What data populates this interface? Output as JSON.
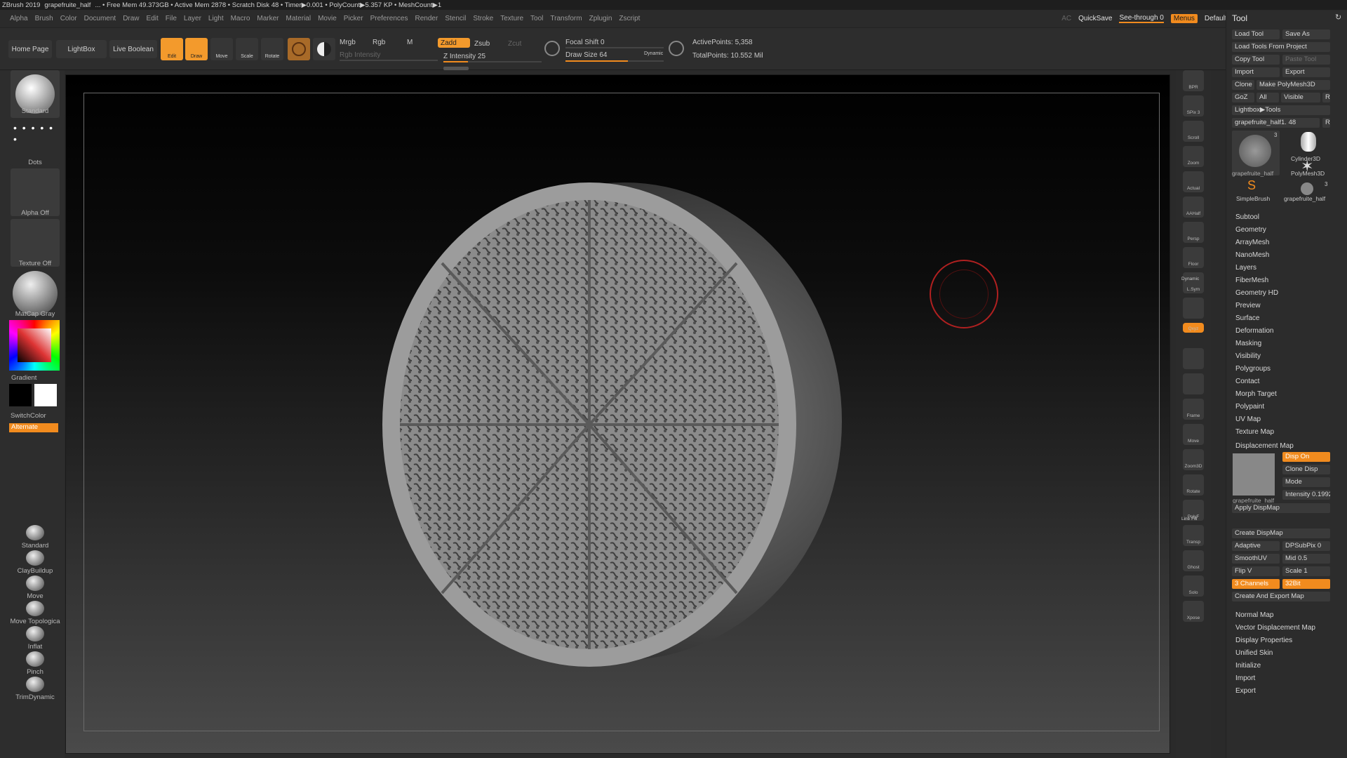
{
  "titlebar": {
    "app": "ZBrush 2019",
    "file": "grapefruite_half",
    "stats": "... • Free Mem 49.373GB • Active Mem 2878 • Scratch Disk 48 • Timer▶0.001 • PolyCount▶5.357 KP • MeshCount▶1"
  },
  "menu": [
    "Alpha",
    "Brush",
    "Color",
    "Document",
    "Draw",
    "Edit",
    "File",
    "Layer",
    "Light",
    "Macro",
    "Marker",
    "Material",
    "Movie",
    "Picker",
    "Preferences",
    "Render",
    "Stencil",
    "Stroke",
    "Texture",
    "Tool",
    "Transform",
    "Zplugin",
    "Zscript"
  ],
  "menu_right": {
    "ac": "AC",
    "quicksave": "QuickSave",
    "seethrough": "See-through  0",
    "menus": "Menus",
    "script": "DefaultZScript"
  },
  "controls": {
    "home": "Home Page",
    "lightbox": "LightBox",
    "live_boolean": "Live Boolean",
    "edit": "Edit",
    "draw": "Draw",
    "move": "Move",
    "scale": "Scale",
    "rotate": "Rotate",
    "mrgb": "Mrgb",
    "rgb": "Rgb",
    "m": "M",
    "rgb_intensity": "Rgb Intensity",
    "zadd": "Zadd",
    "zsub": "Zsub",
    "zcut": "Zcut",
    "z_intensity": "Z Intensity 25",
    "focal_shift": "Focal Shift 0",
    "draw_size": "Draw Size 64",
    "dynamic": "Dynamic",
    "active_points": "ActivePoints: 5,358",
    "total_points": "TotalPoints: 10.552 Mil",
    "z_intensity_value": 25,
    "draw_size_value": 64
  },
  "left": {
    "standard": "Standard",
    "dots": "Dots",
    "alpha_off": "Alpha Off",
    "texture_off": "Texture Off",
    "matcap": "MatCap Gray",
    "gradient": "Gradient",
    "switchcolor": "SwitchColor",
    "alternate": "Alternate",
    "brushes": [
      "Standard",
      "ClayBuildup",
      "Move",
      "Move Topologica",
      "Inflat",
      "Pinch",
      "TrimDynamic"
    ]
  },
  "right_shelf": [
    "BPR",
    "SPix 3",
    "Scroll",
    "Zoom",
    "Actual",
    "AAHalf",
    "Persp",
    "Floor",
    "L.Sym",
    "",
    "Qxyz",
    "",
    "",
    "Frame",
    "Move",
    "Zoom3D",
    "Rotate",
    "PolyF",
    "Transp",
    "Ghost",
    "Solo",
    "Xpose"
  ],
  "right_shelf_extra": {
    "dynamic": "Dynamic",
    "line_fill": "Line Fill"
  },
  "tool": {
    "title": "Tool",
    "load": "Load Tool",
    "save_as": "Save As",
    "load_proj": "Load Tools From Project",
    "copy": "Copy Tool",
    "paste": "Paste Tool",
    "import": "Import",
    "export": "Export",
    "clone": "Clone",
    "make_poly": "Make PolyMesh3D",
    "goz": "GoZ",
    "all": "All",
    "visible": "Visible",
    "r": "R",
    "lightbox_tools": "Lightbox▶Tools",
    "current": "grapefruite_half1. 48",
    "cyl": "Cylinder3D",
    "poly": "PolyMesh3D",
    "simple": "SimpleBrush",
    "thumb1": "grapefruite_half",
    "thumb2": "grapefruite_half",
    "n3a": "3",
    "n3b": "3",
    "items": [
      "Subtool",
      "Geometry",
      "ArrayMesh",
      "NanoMesh",
      "Layers",
      "FiberMesh",
      "Geometry HD",
      "Preview",
      "Surface",
      "Deformation",
      "Masking",
      "Visibility",
      "Polygroups",
      "Contact",
      "Morph Target",
      "Polypaint",
      "UV Map",
      "Texture Map"
    ],
    "disp": {
      "title": "Displacement Map",
      "disp_on": "Disp On",
      "clone_disp": "Clone Disp",
      "mode": "Mode",
      "intensity": "Intensity 0.1992",
      "thumb": "grapefruite_half",
      "apply": "Apply DispMap",
      "create": "Create DispMap",
      "adaptive": "Adaptive",
      "dpsubpix": "DPSubPix 0",
      "smoothuv": "SmoothUV",
      "mid": "Mid 0.5",
      "flipv": "Flip V",
      "scale": "Scale 1",
      "channels": "3 Channels",
      "bit": "32Bit",
      "create_export": "Create And Export Map"
    },
    "items2": [
      "Normal Map",
      "Vector Displacement Map",
      "Display Properties",
      "Unified Skin",
      "Initialize",
      "Import",
      "Export"
    ]
  }
}
